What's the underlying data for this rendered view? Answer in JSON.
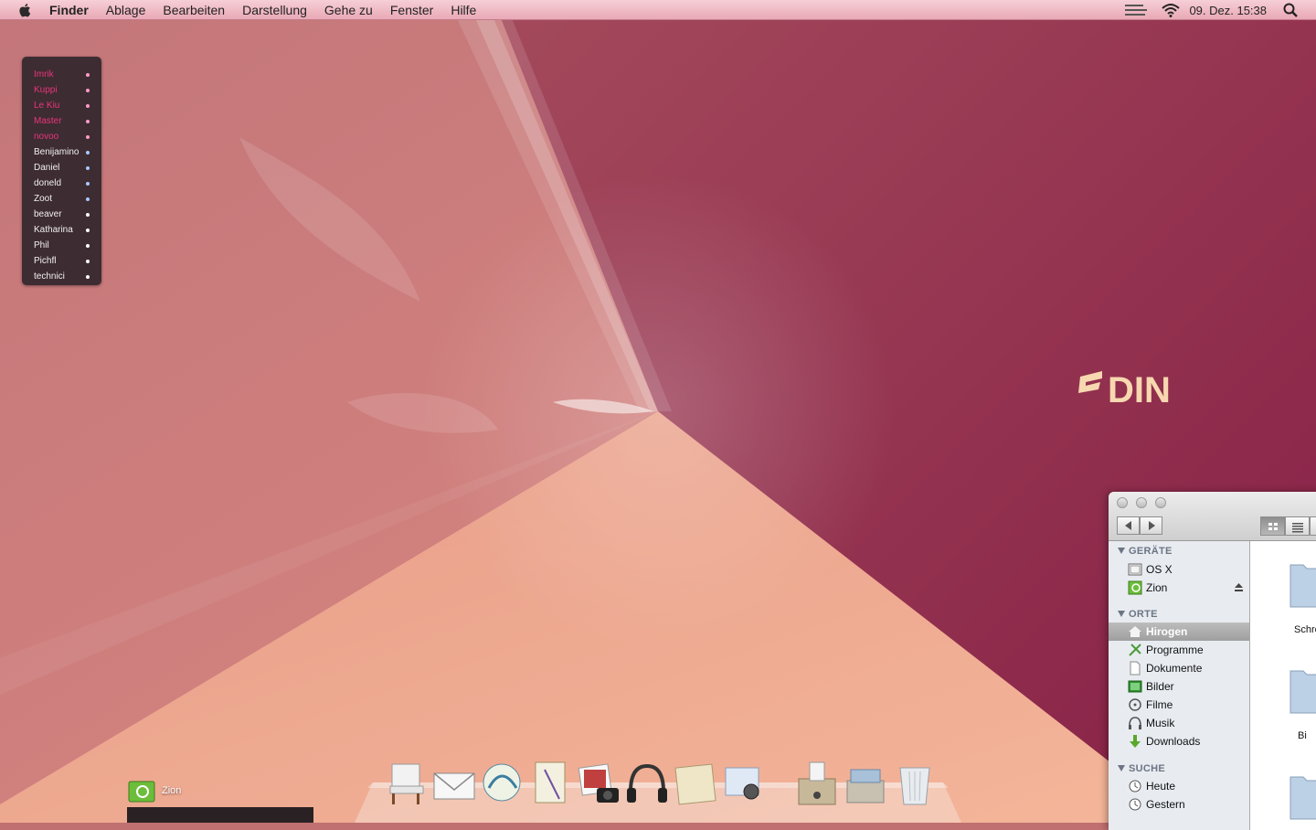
{
  "menubar": {
    "app_name": "Finder",
    "items": [
      "Ablage",
      "Bearbeiten",
      "Darstellung",
      "Gehe zu",
      "Fenster",
      "Hilfe"
    ],
    "clock": "09. Dez. 15:38"
  },
  "buddies": [
    {
      "name": "Imrik",
      "status": "online"
    },
    {
      "name": "Kuppi",
      "status": "online"
    },
    {
      "name": "Le Kiu",
      "status": "online"
    },
    {
      "name": "Master",
      "status": "online"
    },
    {
      "name": "novoo",
      "status": "online"
    },
    {
      "name": "Benijamino",
      "status": "blue"
    },
    {
      "name": "Daniel",
      "status": "blue"
    },
    {
      "name": "doneld",
      "status": "blue"
    },
    {
      "name": "Zoot",
      "status": "blue"
    },
    {
      "name": "beaver",
      "status": "normal"
    },
    {
      "name": "Katharina",
      "status": "normal"
    },
    {
      "name": "Phil",
      "status": "normal"
    },
    {
      "name": "Pichfl",
      "status": "normal"
    },
    {
      "name": "technici",
      "status": "normal"
    }
  ],
  "finder": {
    "sections": {
      "devices": "GERÄTE",
      "places": "ORTE",
      "search": "SUCHE"
    },
    "devices": [
      "OS X",
      "Zion"
    ],
    "places": [
      "Hirogen",
      "Programme",
      "Dokumente",
      "Bilder",
      "Filme",
      "Musik",
      "Downloads"
    ],
    "selected_place": "Hirogen",
    "searches": [
      "Heute",
      "Gestern"
    ],
    "content_labels": [
      "Schre",
      "Bi"
    ]
  },
  "desktop": {
    "drive_label": "Zion",
    "logo_text": "DIN"
  },
  "dock": {
    "icons": [
      "finder-chair-icon",
      "mail-icon",
      "growl-icon",
      "textedit-icon",
      "iphoto-icon",
      "headphones-icon",
      "notes-icon",
      "preview-icon",
      "archive-icon",
      "documents-stack-icon",
      "trash-icon"
    ]
  },
  "colors": {
    "wall_dark": "#8e2a4a",
    "wall_light": "#f0b090",
    "buddy_online": "#e8357a",
    "menubar": "#f0c0ca"
  }
}
